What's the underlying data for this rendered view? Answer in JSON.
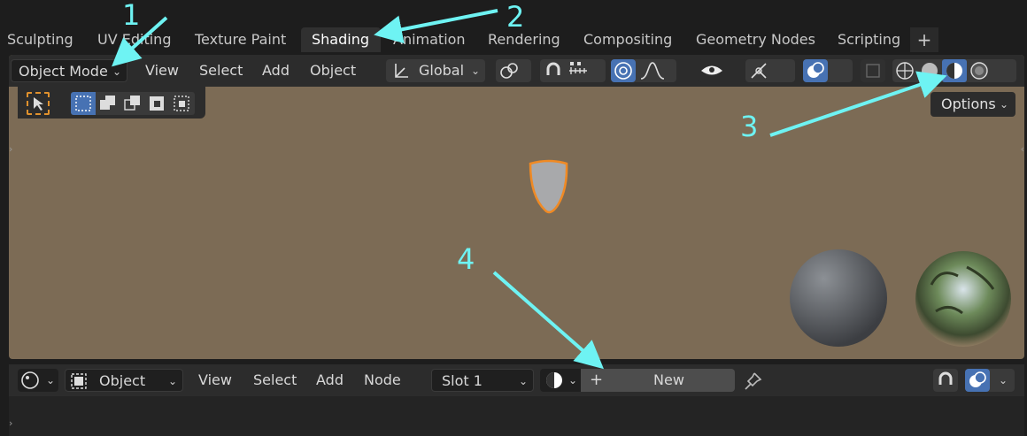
{
  "tabs": [
    {
      "label": "Sculpting",
      "active": false
    },
    {
      "label": "UV Editing",
      "active": false
    },
    {
      "label": "Texture Paint",
      "active": false
    },
    {
      "label": "Shading",
      "active": true
    },
    {
      "label": "Animation",
      "active": false
    },
    {
      "label": "Rendering",
      "active": false
    },
    {
      "label": "Compositing",
      "active": false
    },
    {
      "label": "Geometry Nodes",
      "active": false
    },
    {
      "label": "Scripting",
      "active": false
    }
  ],
  "add_tab_symbol": "+",
  "viewport_header": {
    "mode": "Object Mode",
    "menus": [
      "View",
      "Select",
      "Add",
      "Object"
    ],
    "transform_orientation": "Global",
    "options_label": "Options"
  },
  "node_header": {
    "type": "Object",
    "menus": [
      "View",
      "Select",
      "Add",
      "Node"
    ],
    "slot": "Slot 1",
    "new_symbol": "+",
    "new_label": "New"
  },
  "annotations": [
    "1",
    "2",
    "3",
    "4"
  ],
  "colors": {
    "accent": "#4772b3",
    "annotation": "#6ef3f3",
    "viewport_bg": "#7c6b55",
    "selection": "#f08a24"
  }
}
